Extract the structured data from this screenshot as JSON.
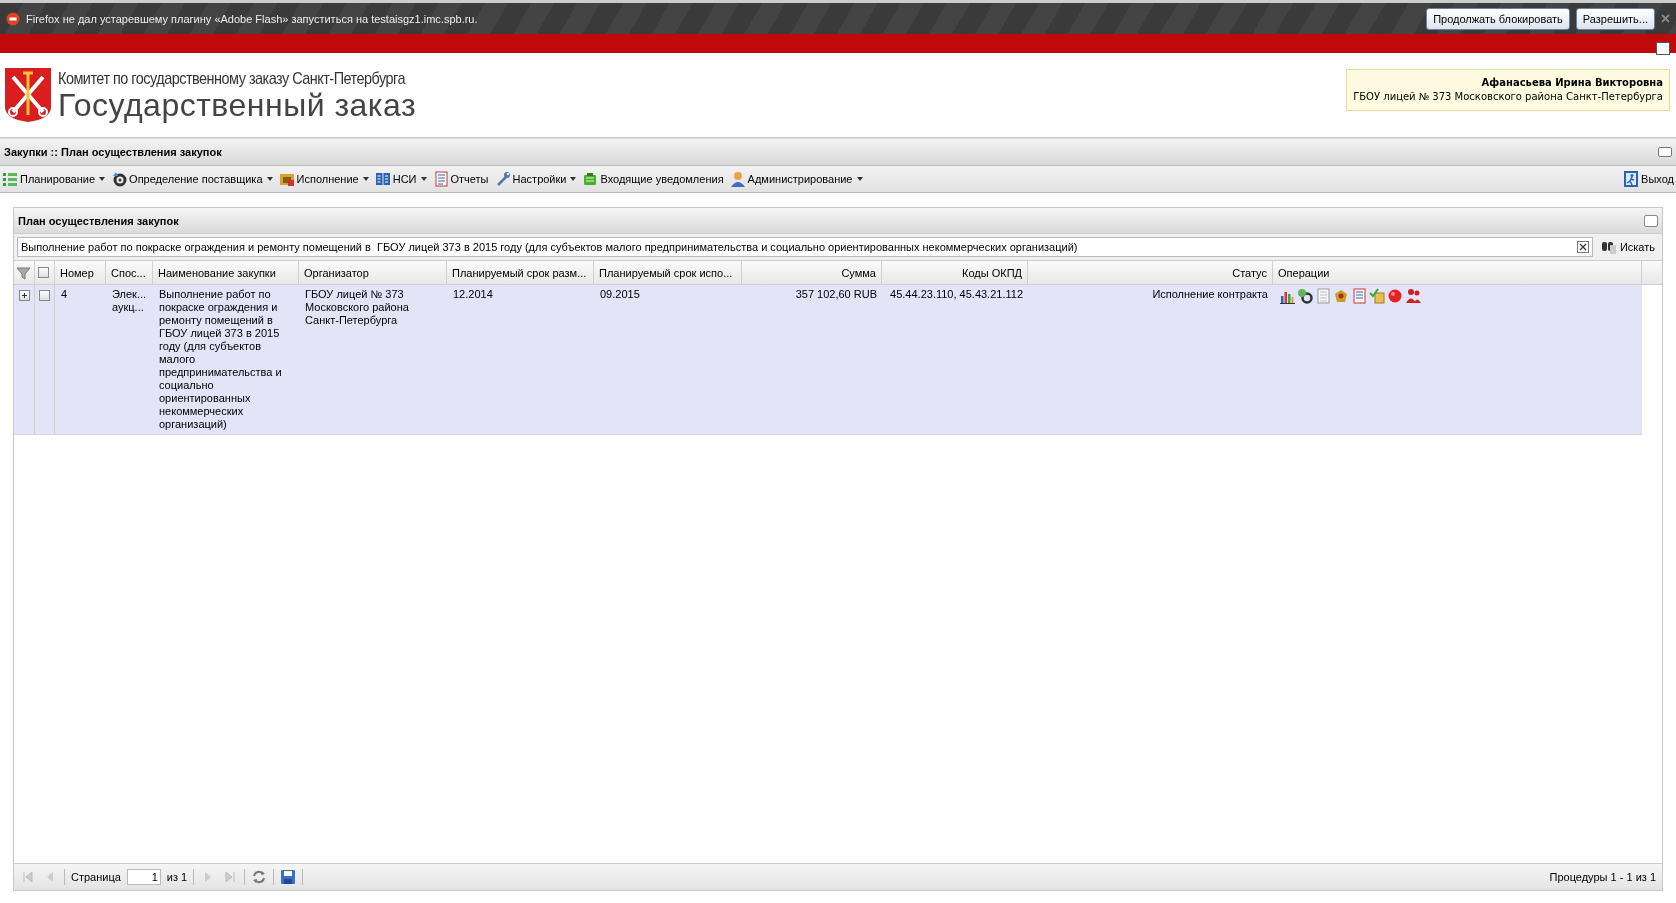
{
  "notification_bar": {
    "message": "Firefox не дал устаревшему плагину «Adobe Flash» запуститься на testaisgz1.imc.spb.ru.",
    "buttons": [
      "Продолжать блокировать",
      "Разрешить..."
    ]
  },
  "header": {
    "subtitle": "Комитет по государственному заказу Санкт-Петербурга",
    "title": "Государственный заказ",
    "user": {
      "name": "Афанасьева Ирина Викторовна",
      "organization": "ГБОУ лицей № 373 Московского района Санкт-Петербурга"
    }
  },
  "breadcrumb": "Закупки :: План осуществления закупок",
  "menu": [
    {
      "label": "Планирование",
      "has_menu": true
    },
    {
      "label": "Определение поставщика",
      "has_menu": true
    },
    {
      "label": "Исполнение",
      "has_menu": true
    },
    {
      "label": "НСИ",
      "has_menu": true
    },
    {
      "label": "Отчеты",
      "has_menu": false
    },
    {
      "label": "Настройки",
      "has_menu": true
    },
    {
      "label": "Входящие уведомления",
      "has_menu": false
    },
    {
      "label": "Администрирование",
      "has_menu": true
    }
  ],
  "logout": "Выход",
  "panel": {
    "title": "План осуществления закупок",
    "search": {
      "value": "Выполнение работ по покраске ограждения и ремонту помещений в  ГБОУ лицей 373 в 2015 году (для субъектов малого предпринимательства и социально ориентированных некоммерческих организаций)",
      "button": "Искать"
    },
    "table": {
      "select_all_checked": false,
      "columns": [
        "Номер",
        "Спос...",
        "Наименование закупки",
        "Организатор",
        "Планируемый срок разм...",
        "Планируемый срок испо...",
        "Сумма",
        "Коды ОКПД",
        "Статус",
        "Операции"
      ],
      "rows": [
        {
          "expanded": false,
          "checked": false,
          "cells": [
            "4",
            "Элек... аукц...",
            "Выполнение работ по покраске ограждения и ремонту помещений в ГБОУ лицей 373 в 2015 году (для субъектов малого предпринимательства и социально ориентированных некоммерческих организаций)",
            "ГБОУ лицей № 373 Московского района Санкт-Петербурга",
            "12.2014",
            "09.2015",
            "357 102,60 RUB",
            "45.44.23.110, 45.43.21.112",
            "Исполнение контракта"
          ]
        }
      ]
    },
    "pager": {
      "page_label": "Страница",
      "page": "1",
      "of": "из 1",
      "summary": "Процедуры 1 - 1 из 1"
    }
  }
}
